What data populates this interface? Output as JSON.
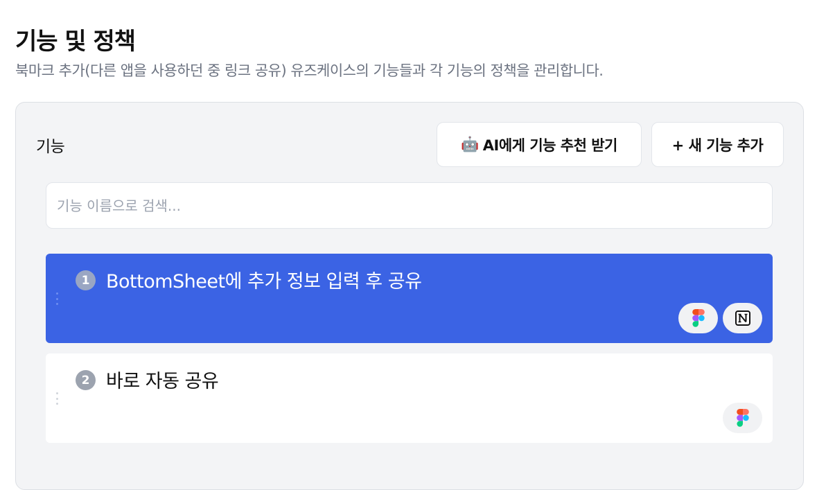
{
  "header": {
    "title": "기능 및 정책",
    "subtitle": "북마크 추가(다른 앱을 사용하던 중 링크 공유) 유즈케이스의 기능들과 각 기능의 정책을 관리합니다."
  },
  "panel": {
    "title": "기능",
    "ai_button": {
      "emoji": "🤖",
      "label": "AI에게 기능 추천 받기"
    },
    "new_button": {
      "label": "+ 새 기능 추가"
    },
    "search": {
      "placeholder": "기능 이름으로 검색...",
      "value": ""
    }
  },
  "features": [
    {
      "number": "1",
      "name": "BottomSheet에 추가 정보 입력 후 공유",
      "selected": true,
      "tools": [
        "figma-icon",
        "notion-icon"
      ]
    },
    {
      "number": "2",
      "name": "바로 자동 공유",
      "selected": false,
      "tools": [
        "figma-icon"
      ]
    }
  ],
  "colors": {
    "selected_card": "#3b63e4",
    "panel_bg": "#f3f4f6",
    "subtitle": "#6b7280"
  }
}
